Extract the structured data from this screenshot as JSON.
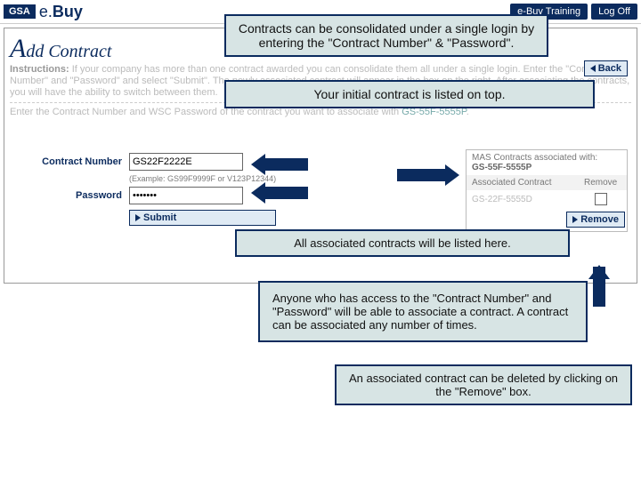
{
  "header": {
    "gsa": "GSA",
    "ebuy_pre": "e.",
    "ebuy_post": "Buy",
    "training": "e-Buy Training",
    "logoff": "Log Off"
  },
  "page": {
    "title_rest": "dd Contract",
    "instructions_label": "Instructions:",
    "instructions_blurred": "If your company has more than one contract awarded you can consolidate them all under a single login. Enter the \"Contract Number\" and \"Password\" and select \"Submit\". The newly associated contract will appear in the box on the right. After associating the contracts, you will have the ability to switch between them.",
    "prompt_blurred": "Enter the Contract Number and WSC Password of the contract you want to associate with",
    "prompt_link": "GS-55F-5555P",
    "back": "Back"
  },
  "form": {
    "contract_label": "Contract Number",
    "contract_value": "GS22F2222E",
    "example": "(Example: GS99F9999F or V123P12344)",
    "password_label": "Password",
    "password_value": "•••••••",
    "submit": "Submit"
  },
  "assoc": {
    "hdr1": "MAS Contracts associated with:",
    "hdr_link": "GS-55F-5555P",
    "col1": "Associated Contract",
    "col2": "Remove",
    "row1": "GS-22F-5555D",
    "remove": "Remove"
  },
  "callouts": {
    "c1": "Contracts can be consolidated under a single login by entering the \"Contract Number\" & \"Password\".",
    "c2": "Your initial contract is listed on top.",
    "c3": "All associated contracts will be listed here.",
    "c4": "Anyone who has access to the \"Contract Number\" and \"Password\" will be able to associate a contract. A contract can be associated any number of times.",
    "c5": "An associated contract can be deleted by clicking on the \"Remove\" box."
  }
}
